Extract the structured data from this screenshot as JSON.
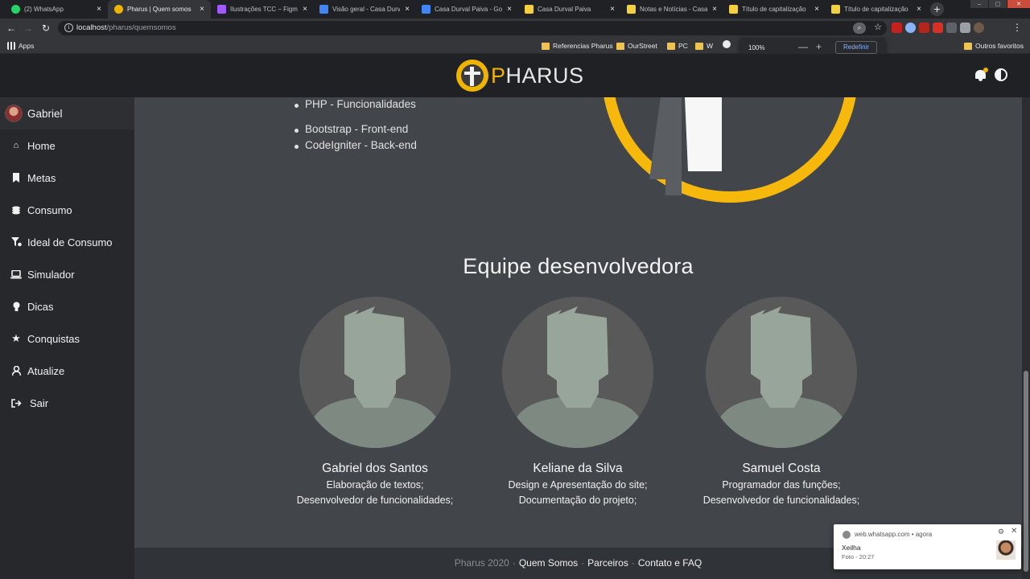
{
  "browser": {
    "tabs": [
      {
        "title": "(2) WhatsApp",
        "color": "#25d366",
        "glyph": "✆",
        "active": false
      },
      {
        "title": "Pharus | Quem somos",
        "color": "#f0b400",
        "glyph": "P",
        "active": true
      },
      {
        "title": "Ilustrações TCC – Figma",
        "color": "#a259ff",
        "glyph": "F",
        "active": false
      },
      {
        "title": "Visão geral - Casa Durv",
        "color": "#4285f4",
        "glyph": "A",
        "active": false
      },
      {
        "title": "Casa Durval Paiva - Goo",
        "color": "#4285f4",
        "glyph": "A",
        "active": false
      },
      {
        "title": "Casa Durval Paiva",
        "color": "#f4d03f",
        "glyph": "C",
        "active": false
      },
      {
        "title": "Notas e Notícias - Casa",
        "color": "#f4d03f",
        "glyph": "C",
        "active": false
      },
      {
        "title": "Título de capitalização",
        "color": "#f4d03f",
        "glyph": "C",
        "active": false
      },
      {
        "title": "Título de capitalização",
        "color": "#f4d03f",
        "glyph": "C",
        "active": false
      }
    ],
    "url_host": "localhost",
    "url_path": "/pharus/quemsomos",
    "bookmarks": {
      "apps": "Apps",
      "folders": [
        "Referencias Pharus",
        "OurStreet",
        "PC",
        "W"
      ],
      "other": "Outros favoritos"
    },
    "zoom": {
      "value": "100%",
      "minus": "—",
      "plus": "+",
      "reset": "Redefinir"
    }
  },
  "header": {
    "brand_initial": "P",
    "brand_rest": "HARUS"
  },
  "sidebar": {
    "user": "Gabriel",
    "items": [
      {
        "label": "Home",
        "icon": "home-icon"
      },
      {
        "label": "Metas",
        "icon": "bookmark-icon"
      },
      {
        "label": "Consumo",
        "icon": "coins-icon"
      },
      {
        "label": "Ideal de Consumo",
        "icon": "filter-icon"
      },
      {
        "label": "Simulador",
        "icon": "laptop-icon"
      },
      {
        "label": "Dicas",
        "icon": "lightbulb-icon"
      },
      {
        "label": "Conquistas",
        "icon": "star-icon"
      },
      {
        "label": "Atualize",
        "icon": "user-icon"
      },
      {
        "label": "Sair",
        "icon": "sign-out-icon"
      }
    ]
  },
  "main": {
    "tech_list": [
      "PHP - Funcionalidades",
      "Bootstrap - Front-end",
      "CodeIgniter - Back-end"
    ],
    "team_title": "Equipe desenvolvedora",
    "members": [
      {
        "name": "Gabriel dos Santos",
        "role1": "Elaboração de textos;",
        "role2": "Desenvolvedor de funcionalidades;"
      },
      {
        "name": "Keliane da Silva",
        "role1": "Design e Apresentação do site;",
        "role2": "Documentação do projeto;"
      },
      {
        "name": "Samuel Costa",
        "role1": "Programador das funções;",
        "role2": "Desenvolvedor de funcionalidades;"
      }
    ]
  },
  "footer": {
    "copyright": "Pharus 2020",
    "links": [
      "Quem Somos",
      "Parceiros",
      "Contato e FAQ"
    ]
  },
  "notification": {
    "source": "web.whatsapp.com",
    "time": "agora",
    "title": "Xeilha",
    "message": "Foto - 20:27"
  },
  "colors": {
    "accent": "#f0b400",
    "sidebar_bg": "#26282b",
    "main_bg": "#42464b",
    "header_bg": "#202124"
  }
}
